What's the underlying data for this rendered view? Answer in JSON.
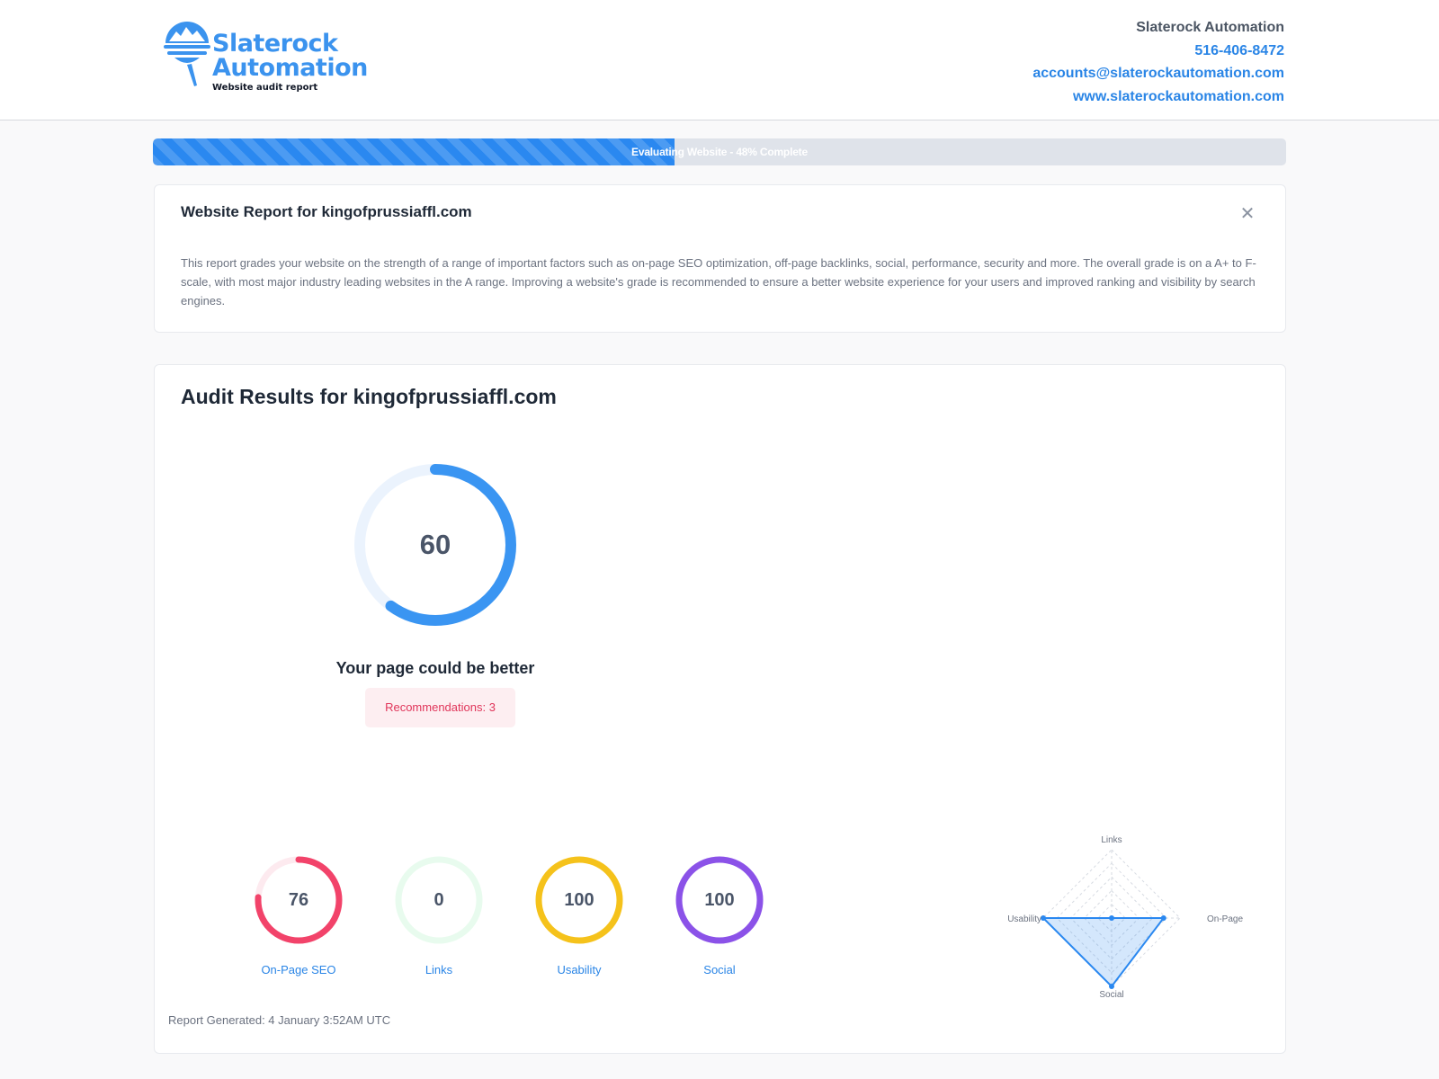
{
  "brand": {
    "logo_line1": "Slaterock",
    "logo_line2": "Automation",
    "tagline": "Website audit report",
    "color": "#3b93ee"
  },
  "contact": {
    "company": "Slaterock Automation",
    "phone": "516-406-8472",
    "email": "accounts@slaterockautomation.com",
    "website": "www.slaterockautomation.com"
  },
  "progress": {
    "label": "Evaluating Website - 48% Complete",
    "percent": 46
  },
  "intro": {
    "title": "Website Report for kingofprussiaffl.com",
    "close_icon": "close-icon",
    "body": "This report grades your website on the strength of a range of important factors such as on-page SEO optimization, off-page backlinks, social, performance, security and more. The overall grade is on a A+ to F-scale, with most major industry leading websites in the A range. Improving a website's grade is recommended to ensure a better website experience for your users and improved ranking and visibility by search engines."
  },
  "audit": {
    "title": "Audit Results for kingofprussiaffl.com",
    "overall": {
      "score": "60",
      "fraction": 0.6,
      "color": "#3a95f2",
      "track": "#ebf3fd"
    },
    "verdict": "Your page could be better",
    "recommendations": "Recommendations: 3",
    "categories": [
      {
        "key": "onpage",
        "label": "On-Page SEO",
        "score": "76",
        "fraction": 0.76,
        "color": "#f2436a",
        "track": "#fdeaef"
      },
      {
        "key": "links",
        "label": "Links",
        "score": "0",
        "fraction": 0,
        "color": "#22c55e",
        "track": "#e8fbee"
      },
      {
        "key": "usability",
        "label": "Usability",
        "score": "100",
        "fraction": 1,
        "color": "#f5c21b",
        "track": "#fdf6dc"
      },
      {
        "key": "social",
        "label": "Social",
        "score": "100",
        "fraction": 1,
        "color": "#8b52e8",
        "track": "#efe7fd"
      }
    ],
    "radar": {
      "axes": [
        "Links",
        "On-Page SEO",
        "Social",
        "Usability"
      ],
      "values": [
        0,
        76,
        100,
        100
      ],
      "max": 100,
      "color": "#2a88f0"
    },
    "generated": "Report Generated: 4 January 3:52AM UTC"
  }
}
